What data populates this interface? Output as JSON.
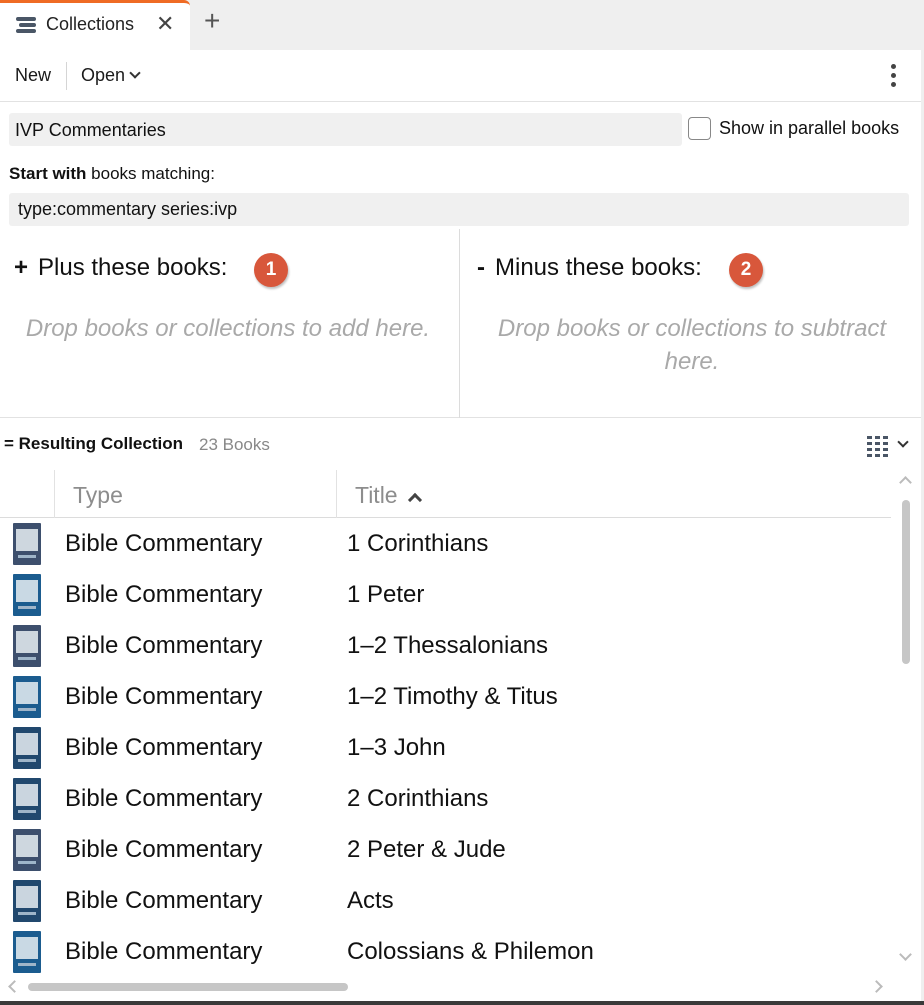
{
  "tab": {
    "label": "Collections",
    "close_glyph": "✕",
    "add_glyph": "+"
  },
  "toolbar": {
    "new_label": "New",
    "open_label": "Open"
  },
  "collection": {
    "name": "IVP Commentaries",
    "parallel_label": "Show in parallel books",
    "start_bold": "Start with",
    "start_rest": " books matching:",
    "query": "type:commentary series:ivp"
  },
  "plus": {
    "sign": "+",
    "title": "Plus these books:",
    "badge": "1",
    "hint": "Drop books or collections to add here."
  },
  "minus": {
    "sign": "-",
    "title": "Minus these books:",
    "badge": "2",
    "hint": "Drop books or collections to subtract here."
  },
  "result": {
    "title": "= Resulting Collection",
    "count": "23 Books"
  },
  "table": {
    "columns": [
      "Type",
      "Title"
    ],
    "rows": [
      {
        "type": "Bible Commentary",
        "title": "1 Corinthians"
      },
      {
        "type": "Bible Commentary",
        "title": "1 Peter"
      },
      {
        "type": "Bible Commentary",
        "title": "1–2 Thessalonians"
      },
      {
        "type": "Bible Commentary",
        "title": "1–2 Timothy & Titus"
      },
      {
        "type": "Bible Commentary",
        "title": "1–3 John"
      },
      {
        "type": "Bible Commentary",
        "title": "2 Corinthians"
      },
      {
        "type": "Bible Commentary",
        "title": "2 Peter & Jude"
      },
      {
        "type": "Bible Commentary",
        "title": "Acts"
      },
      {
        "type": "Bible Commentary",
        "title": "Colossians & Philemon"
      }
    ]
  },
  "colors": {
    "accent": "#ef6b24",
    "badge": "#d8573b",
    "cover": "#21486e"
  },
  "icons": [
    "collections-icon",
    "close-icon",
    "plus-icon",
    "chevron-down-icon",
    "kebab-menu-icon",
    "grid-view-icon",
    "sort-ascending-icon",
    "book-cover-icon"
  ]
}
